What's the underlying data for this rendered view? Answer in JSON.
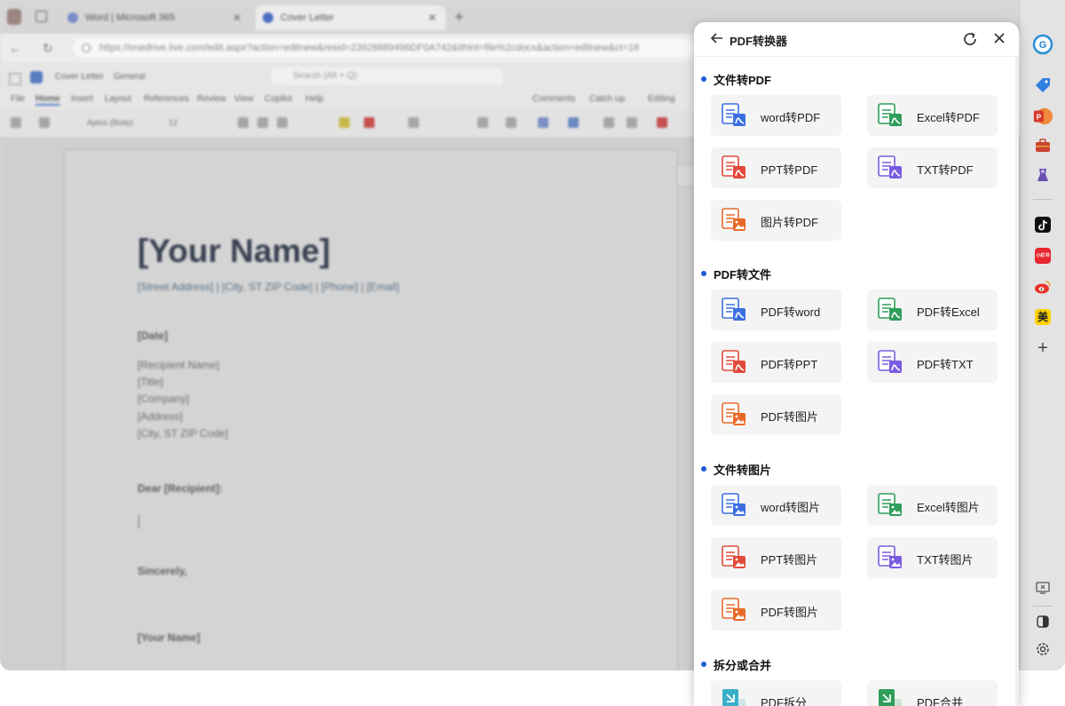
{
  "browser": {
    "tabs": [
      {
        "label": "Word | Microsoft 365"
      },
      {
        "label": "Cover Letter"
      }
    ],
    "url": "https://onedrive.live.com/edit.aspx?action=editnew&resid=23928889496DF0A742&ithint=file%2cdocx&action=editnew&ct=16"
  },
  "word": {
    "doc_title": "Cover Letter",
    "sensitivity": "General",
    "search_placeholder": "Search (Alt + Q)",
    "menu": [
      "File",
      "Home",
      "Insert",
      "Layout",
      "References",
      "Review",
      "View",
      "Copilot",
      "Help"
    ],
    "font_name": "Aptos (Body)",
    "font_size": "12",
    "comments": "Comments",
    "catch_up": "Catch up",
    "editing": "Editing"
  },
  "document": {
    "name": "[Your Name]",
    "contact": "[Street Address] | [City, ST ZIP Code] | [Phone] | [Email]",
    "date": "[Date]",
    "recipient_lines": [
      "[Recipient Name]",
      "[Title]",
      "[Company]",
      "[Address]",
      "[City, ST ZIP Code]"
    ],
    "salutation": "Dear [Recipient]:",
    "closing": "Sincerely,",
    "signature": "[Your Name]"
  },
  "panel": {
    "title": "PDF转换器",
    "sections": [
      {
        "title": "文件转PDF",
        "items": [
          {
            "label": "word转PDF",
            "icon": "word-to-pdf-icon",
            "color": "#3b6fe0"
          },
          {
            "label": "Excel转PDF",
            "icon": "excel-to-pdf-icon",
            "color": "#2e9e5a"
          },
          {
            "label": "PPT转PDF",
            "icon": "ppt-to-pdf-icon",
            "color": "#e24a3a"
          },
          {
            "label": "TXT转PDF",
            "icon": "txt-to-pdf-icon",
            "color": "#7a5ce0"
          },
          {
            "label": "图片转PDF",
            "icon": "image-to-pdf-icon",
            "color": "#e86a28"
          }
        ]
      },
      {
        "title": "PDF转文件",
        "items": [
          {
            "label": "PDF转word",
            "icon": "pdf-to-word-icon",
            "color": "#3b6fe0"
          },
          {
            "label": "PDF转Excel",
            "icon": "pdf-to-excel-icon",
            "color": "#2e9e5a"
          },
          {
            "label": "PDF转PPT",
            "icon": "pdf-to-ppt-icon",
            "color": "#e24a3a"
          },
          {
            "label": "PDF转TXT",
            "icon": "pdf-to-txt-icon",
            "color": "#7a5ce0"
          },
          {
            "label": "PDF转图片",
            "icon": "pdf-to-image-icon",
            "color": "#e86a28"
          }
        ]
      },
      {
        "title": "文件转图片",
        "items": [
          {
            "label": "word转图片",
            "icon": "word-to-image-icon",
            "color": "#3b6fe0"
          },
          {
            "label": "Excel转图片",
            "icon": "excel-to-image-icon",
            "color": "#2e9e5a"
          },
          {
            "label": "PPT转图片",
            "icon": "ppt-to-image-icon",
            "color": "#e24a3a"
          },
          {
            "label": "TXT转图片",
            "icon": "txt-to-image-icon",
            "color": "#7a5ce0"
          },
          {
            "label": "PDF转图片",
            "icon": "pdf-to-image-icon",
            "color": "#e86a28"
          }
        ]
      },
      {
        "title": "拆分或合并",
        "items": [
          {
            "label": "PDF拆分",
            "icon": "pdf-split-icon",
            "color": "#3ab0c8"
          },
          {
            "label": "PDF合并",
            "icon": "pdf-merge-icon",
            "color": "#2e9e5a"
          }
        ]
      }
    ]
  },
  "rail": {
    "items": [
      "copilot-icon",
      "tag-icon",
      "pdf-converter-icon",
      "toolbox-icon",
      "game-icon",
      "tiktok-icon",
      "xiaohongshu-icon",
      "weibo-icon",
      "meituan-icon",
      "add-icon",
      "screen-icon",
      "theme-icon",
      "settings-icon"
    ],
    "xiaohongshu_text": "小红书",
    "meituan_text": "美"
  }
}
